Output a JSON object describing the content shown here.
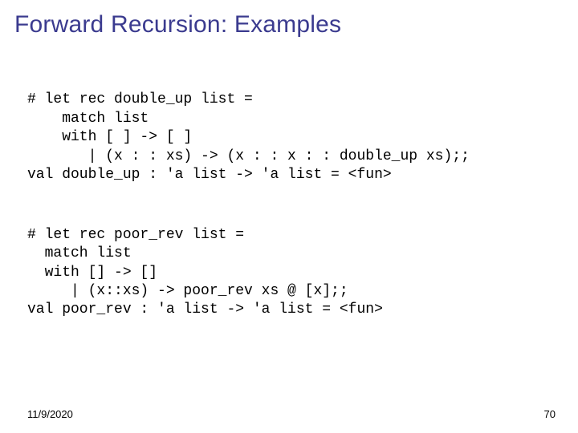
{
  "title": "Forward Recursion: Examples",
  "code1_l1": "# let rec double_up list =",
  "code1_l2": "    match list",
  "code1_l3": "    with [ ] -> [ ]",
  "code1_l4": "       | (x : : xs) -> (x : : x : : double_up xs);;",
  "code1_l5": "val double_up : 'a list -> 'a list = <fun>",
  "code2_l1": "# let rec poor_rev list =",
  "code2_l2": "  match list",
  "code2_l3": "  with [] -> []",
  "code2_l4": "     | (x::xs) -> poor_rev xs @ [x];;",
  "code2_l5": "val poor_rev : 'a list -> 'a list = <fun>",
  "footer_date": "11/9/2020",
  "footer_page": "70"
}
